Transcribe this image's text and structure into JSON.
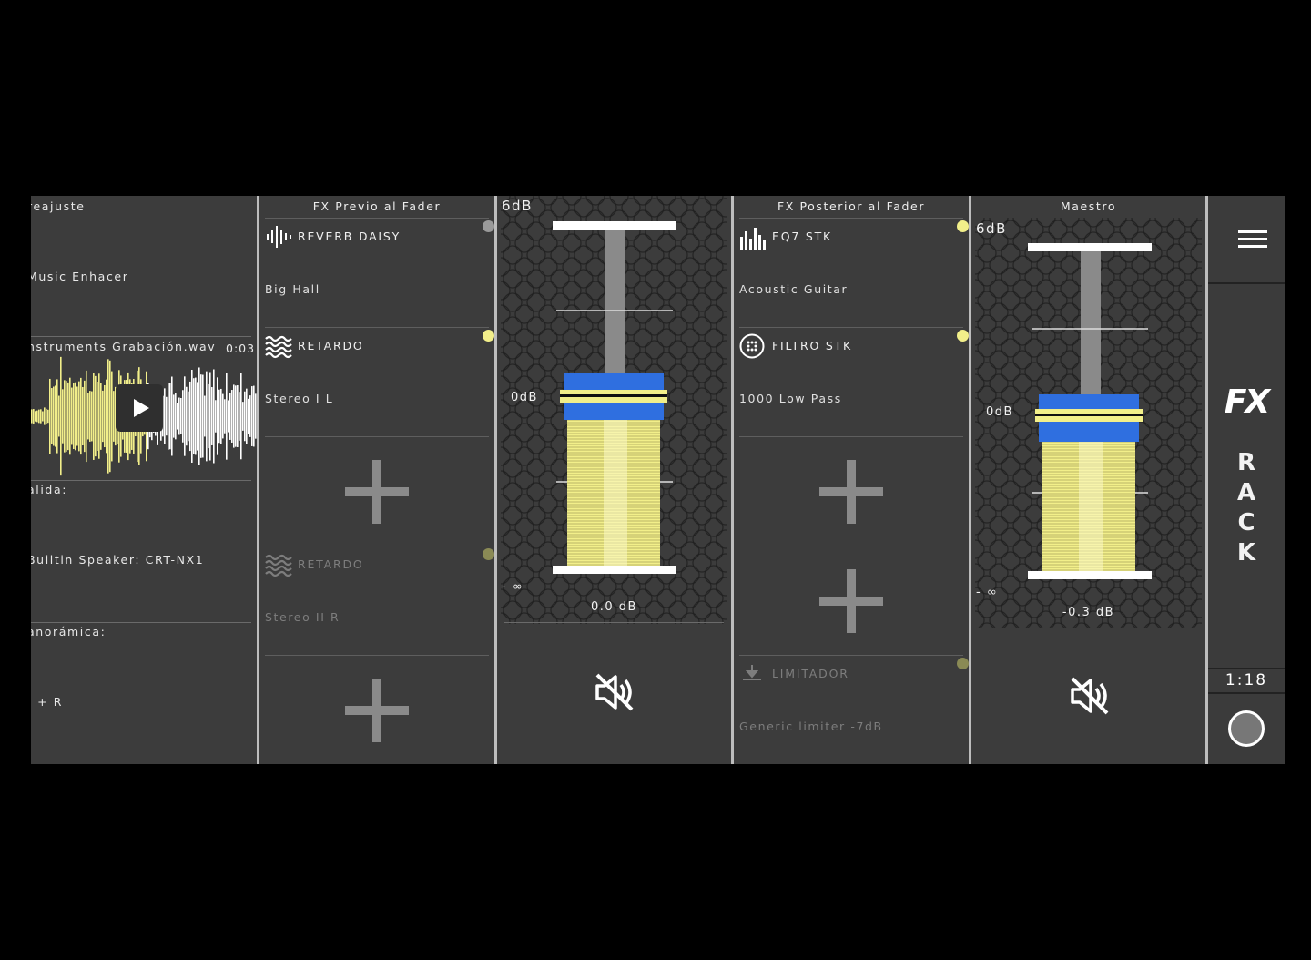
{
  "colors": {
    "accent_yellow": "#f2ef8a",
    "accent_blue": "#2f6fe0",
    "dot_grey": "#9a9a9a",
    "dot_olive": "#8a8a55"
  },
  "source_panel": {
    "preset_label": "reajuste",
    "preset_value": "Music Enhacer",
    "file_name": "nstruments Grabación.wav",
    "file_time": "0:03",
    "output_label": "alida:",
    "output_value": "Builtin Speaker: CRT-NX1",
    "pan_label": "anorámica:",
    "pan_value": ". + R"
  },
  "pre_fx": {
    "header": "FX Previo al Fader",
    "slots": [
      {
        "name": "REVERB DAISY",
        "sub": "Big Hall",
        "icon": "waveform-icon",
        "dot": "grey"
      },
      {
        "name": "RETARDO",
        "sub": "Stereo I L",
        "icon": "waves-icon",
        "dot": "yellow"
      },
      {
        "name": "RETARDO",
        "sub": "Stereo II R",
        "icon": "waves-icon",
        "dot": "olive"
      }
    ]
  },
  "channel_fader": {
    "max_label": "6dB",
    "zero_label": "0dB",
    "min_label": "- ∞",
    "value": "0.0 dB",
    "level": 0.55
  },
  "post_fx": {
    "header": "FX Posterior al Fader",
    "slots": [
      {
        "name": "EQ7 STK",
        "sub": "Acoustic Guitar",
        "icon": "equalizer-icon",
        "dot": "yellow"
      },
      {
        "name": "FILTRO STK",
        "sub": "1000 Low Pass",
        "icon": "filter-icon",
        "dot": "yellow"
      },
      {
        "name": "LIMITADOR",
        "sub": "Generic limiter -7dB",
        "icon": "limiter-icon",
        "dot": "olive"
      }
    ]
  },
  "master": {
    "header": "Maestro",
    "max_label": "6dB",
    "zero_label": "0dB",
    "min_label": "- ∞",
    "value": "-0.3 dB",
    "level": 0.52
  },
  "sidebar": {
    "logo": "FX",
    "rack_letters": [
      "R",
      "A",
      "C",
      "K"
    ],
    "time": "1:18"
  }
}
